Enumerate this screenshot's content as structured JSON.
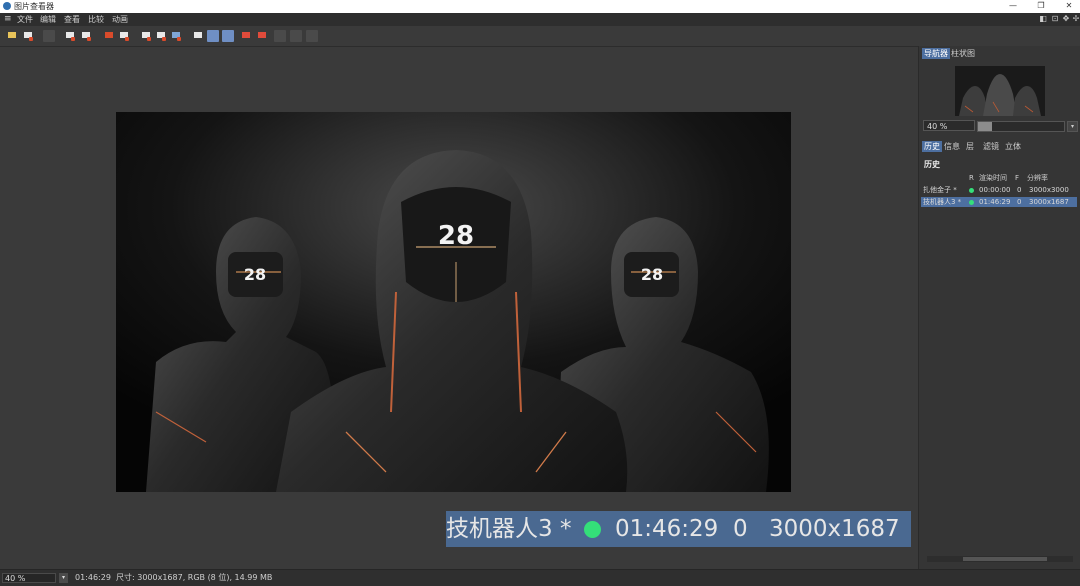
{
  "window": {
    "title": "图片查看器",
    "minimize": "—",
    "maximize": "❐",
    "close": "✕"
  },
  "menu": [
    "文件",
    "编辑",
    "查看",
    "比较",
    "动画"
  ],
  "navigator_tabs": [
    "导航器",
    "柱状图"
  ],
  "zoom": {
    "value": "40 %"
  },
  "info_tabs": [
    "历史",
    "信息",
    "层",
    "滤镜",
    "立体"
  ],
  "history": {
    "heading": "历史",
    "columns": {
      "r": "R",
      "time": "渲染时间",
      "f": "F",
      "res": "分辨率"
    },
    "rows": [
      {
        "name": "扎他金子 *",
        "time": "00:00:00",
        "f": "0",
        "res": "3000x3000",
        "selected": false
      },
      {
        "name": "技机器人3 *",
        "time": "01:46:29",
        "f": "0",
        "res": "3000x1687",
        "selected": true
      }
    ]
  },
  "overlay": {
    "name": "技机器人3 *",
    "time": "01:46:29",
    "f": "0",
    "res": "3000x1687"
  },
  "status": {
    "zoom": "40 %",
    "time": "01:46:29",
    "info": "尺寸: 3000x1687, RGB (8 位), 14.99 MB"
  },
  "image": {
    "badge": "28"
  },
  "colors": {
    "accent": "#4d6fa0",
    "status_dot": "#35e07a",
    "overlay_bg": "#4a6991"
  }
}
